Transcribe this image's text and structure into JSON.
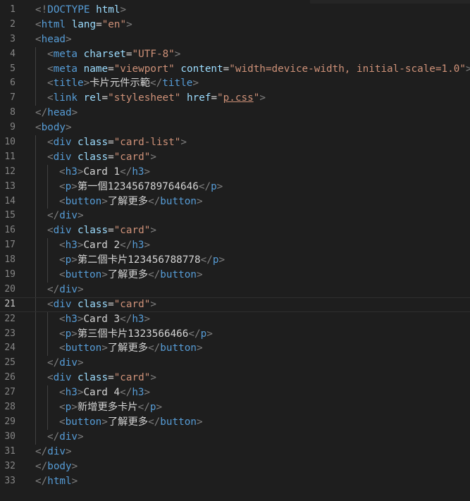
{
  "editor": {
    "language": "html",
    "current_line": 21,
    "colors": {
      "background": "#1e1e1e",
      "tag": "#569cd6",
      "bracket": "#808080",
      "attribute": "#9cdcfe",
      "string": "#ce9178",
      "text": "#d4d4d4",
      "line_number": "#858585"
    },
    "lines": [
      {
        "n": "1",
        "indent": 0,
        "tokens": [
          [
            "b",
            "<!"
          ],
          [
            "t",
            "DOCTYPE"
          ],
          [
            "e",
            " "
          ],
          [
            "a",
            "html"
          ],
          [
            "b",
            ">"
          ]
        ]
      },
      {
        "n": "2",
        "indent": 0,
        "tokens": [
          [
            "b",
            "<"
          ],
          [
            "t",
            "html"
          ],
          [
            "e",
            " "
          ],
          [
            "a",
            "lang"
          ],
          [
            "e",
            "="
          ],
          [
            "s",
            "\"en\""
          ],
          [
            "b",
            ">"
          ]
        ]
      },
      {
        "n": "3",
        "indent": 0,
        "tokens": [
          [
            "b",
            "<"
          ],
          [
            "t",
            "head"
          ],
          [
            "b",
            ">"
          ]
        ]
      },
      {
        "n": "4",
        "indent": 1,
        "tokens": [
          [
            "b",
            "<"
          ],
          [
            "t",
            "meta"
          ],
          [
            "e",
            " "
          ],
          [
            "a",
            "charset"
          ],
          [
            "e",
            "="
          ],
          [
            "s",
            "\"UTF-8\""
          ],
          [
            "b",
            ">"
          ]
        ]
      },
      {
        "n": "5",
        "indent": 1,
        "tokens": [
          [
            "b",
            "<"
          ],
          [
            "t",
            "meta"
          ],
          [
            "e",
            " "
          ],
          [
            "a",
            "name"
          ],
          [
            "e",
            "="
          ],
          [
            "s",
            "\"viewport\""
          ],
          [
            "e",
            " "
          ],
          [
            "a",
            "content"
          ],
          [
            "e",
            "="
          ],
          [
            "s",
            "\"width=device-width, initial-scale=1.0\""
          ],
          [
            "b",
            ">"
          ]
        ]
      },
      {
        "n": "6",
        "indent": 1,
        "tokens": [
          [
            "b",
            "<"
          ],
          [
            "t",
            "title"
          ],
          [
            "b",
            ">"
          ],
          [
            "e",
            "卡片元件示範"
          ],
          [
            "b",
            "</"
          ],
          [
            "t",
            "title"
          ],
          [
            "b",
            ">"
          ]
        ]
      },
      {
        "n": "7",
        "indent": 1,
        "tokens": [
          [
            "b",
            "<"
          ],
          [
            "t",
            "link"
          ],
          [
            "e",
            " "
          ],
          [
            "a",
            "rel"
          ],
          [
            "e",
            "="
          ],
          [
            "s",
            "\"stylesheet\""
          ],
          [
            "e",
            " "
          ],
          [
            "a",
            "href"
          ],
          [
            "e",
            "="
          ],
          [
            "s",
            "\""
          ],
          [
            "su",
            "p.css"
          ],
          [
            "s",
            "\""
          ],
          [
            "b",
            ">"
          ]
        ]
      },
      {
        "n": "8",
        "indent": 0,
        "tokens": [
          [
            "b",
            "</"
          ],
          [
            "t",
            "head"
          ],
          [
            "b",
            ">"
          ]
        ]
      },
      {
        "n": "9",
        "indent": 0,
        "tokens": [
          [
            "b",
            "<"
          ],
          [
            "t",
            "body"
          ],
          [
            "b",
            ">"
          ]
        ]
      },
      {
        "n": "10",
        "indent": 1,
        "tokens": [
          [
            "b",
            "<"
          ],
          [
            "t",
            "div"
          ],
          [
            "e",
            " "
          ],
          [
            "a",
            "class"
          ],
          [
            "e",
            "="
          ],
          [
            "s",
            "\"card-list\""
          ],
          [
            "b",
            ">"
          ]
        ]
      },
      {
        "n": "11",
        "indent": 1,
        "tokens": [
          [
            "b",
            "<"
          ],
          [
            "t",
            "div"
          ],
          [
            "e",
            " "
          ],
          [
            "a",
            "class"
          ],
          [
            "e",
            "="
          ],
          [
            "s",
            "\"card\""
          ],
          [
            "b",
            ">"
          ]
        ]
      },
      {
        "n": "12",
        "indent": 2,
        "tokens": [
          [
            "b",
            "<"
          ],
          [
            "t",
            "h3"
          ],
          [
            "b",
            ">"
          ],
          [
            "e",
            "Card 1"
          ],
          [
            "b",
            "</"
          ],
          [
            "t",
            "h3"
          ],
          [
            "b",
            ">"
          ]
        ]
      },
      {
        "n": "13",
        "indent": 2,
        "tokens": [
          [
            "b",
            "<"
          ],
          [
            "t",
            "p"
          ],
          [
            "b",
            ">"
          ],
          [
            "e",
            "第一個123456789764646"
          ],
          [
            "b",
            "</"
          ],
          [
            "t",
            "p"
          ],
          [
            "b",
            ">"
          ]
        ]
      },
      {
        "n": "14",
        "indent": 2,
        "tokens": [
          [
            "b",
            "<"
          ],
          [
            "t",
            "button"
          ],
          [
            "b",
            ">"
          ],
          [
            "e",
            "了解更多"
          ],
          [
            "b",
            "</"
          ],
          [
            "t",
            "button"
          ],
          [
            "b",
            ">"
          ]
        ]
      },
      {
        "n": "15",
        "indent": 1,
        "tokens": [
          [
            "b",
            "</"
          ],
          [
            "t",
            "div"
          ],
          [
            "b",
            ">"
          ]
        ]
      },
      {
        "n": "16",
        "indent": 1,
        "tokens": [
          [
            "b",
            "<"
          ],
          [
            "t",
            "div"
          ],
          [
            "e",
            " "
          ],
          [
            "a",
            "class"
          ],
          [
            "e",
            "="
          ],
          [
            "s",
            "\"card\""
          ],
          [
            "b",
            ">"
          ]
        ]
      },
      {
        "n": "17",
        "indent": 2,
        "tokens": [
          [
            "b",
            "<"
          ],
          [
            "t",
            "h3"
          ],
          [
            "b",
            ">"
          ],
          [
            "e",
            "Card 2"
          ],
          [
            "b",
            "</"
          ],
          [
            "t",
            "h3"
          ],
          [
            "b",
            ">"
          ]
        ]
      },
      {
        "n": "18",
        "indent": 2,
        "tokens": [
          [
            "b",
            "<"
          ],
          [
            "t",
            "p"
          ],
          [
            "b",
            ">"
          ],
          [
            "e",
            "第二個卡片123456788778"
          ],
          [
            "b",
            "</"
          ],
          [
            "t",
            "p"
          ],
          [
            "b",
            ">"
          ]
        ]
      },
      {
        "n": "19",
        "indent": 2,
        "tokens": [
          [
            "b",
            "<"
          ],
          [
            "t",
            "button"
          ],
          [
            "b",
            ">"
          ],
          [
            "e",
            "了解更多"
          ],
          [
            "b",
            "</"
          ],
          [
            "t",
            "button"
          ],
          [
            "b",
            ">"
          ]
        ]
      },
      {
        "n": "20",
        "indent": 1,
        "tokens": [
          [
            "b",
            "</"
          ],
          [
            "t",
            "div"
          ],
          [
            "b",
            ">"
          ]
        ]
      },
      {
        "n": "21",
        "indent": 1,
        "tokens": [
          [
            "b",
            "<"
          ],
          [
            "t",
            "div"
          ],
          [
            "e",
            " "
          ],
          [
            "a",
            "class"
          ],
          [
            "e",
            "="
          ],
          [
            "s",
            "\"card\""
          ],
          [
            "b",
            ">"
          ]
        ]
      },
      {
        "n": "22",
        "indent": 2,
        "tokens": [
          [
            "b",
            "<"
          ],
          [
            "t",
            "h3"
          ],
          [
            "b",
            ">"
          ],
          [
            "e",
            "Card 3"
          ],
          [
            "b",
            "</"
          ],
          [
            "t",
            "h3"
          ],
          [
            "b",
            ">"
          ]
        ]
      },
      {
        "n": "23",
        "indent": 2,
        "tokens": [
          [
            "b",
            "<"
          ],
          [
            "t",
            "p"
          ],
          [
            "b",
            ">"
          ],
          [
            "e",
            "第三個卡片1323566466"
          ],
          [
            "b",
            "</"
          ],
          [
            "t",
            "p"
          ],
          [
            "b",
            ">"
          ]
        ]
      },
      {
        "n": "24",
        "indent": 2,
        "tokens": [
          [
            "b",
            "<"
          ],
          [
            "t",
            "button"
          ],
          [
            "b",
            ">"
          ],
          [
            "e",
            "了解更多"
          ],
          [
            "b",
            "</"
          ],
          [
            "t",
            "button"
          ],
          [
            "b",
            ">"
          ]
        ]
      },
      {
        "n": "25",
        "indent": 1,
        "tokens": [
          [
            "b",
            "</"
          ],
          [
            "t",
            "div"
          ],
          [
            "b",
            ">"
          ]
        ]
      },
      {
        "n": "26",
        "indent": 1,
        "tokens": [
          [
            "b",
            "<"
          ],
          [
            "t",
            "div"
          ],
          [
            "e",
            " "
          ],
          [
            "a",
            "class"
          ],
          [
            "e",
            "="
          ],
          [
            "s",
            "\"card\""
          ],
          [
            "b",
            ">"
          ]
        ]
      },
      {
        "n": "27",
        "indent": 2,
        "tokens": [
          [
            "b",
            "<"
          ],
          [
            "t",
            "h3"
          ],
          [
            "b",
            ">"
          ],
          [
            "e",
            "Card 4"
          ],
          [
            "b",
            "</"
          ],
          [
            "t",
            "h3"
          ],
          [
            "b",
            ">"
          ]
        ]
      },
      {
        "n": "28",
        "indent": 2,
        "tokens": [
          [
            "b",
            "<"
          ],
          [
            "t",
            "p"
          ],
          [
            "b",
            ">"
          ],
          [
            "e",
            "新增更多卡片"
          ],
          [
            "b",
            "</"
          ],
          [
            "t",
            "p"
          ],
          [
            "b",
            ">"
          ]
        ]
      },
      {
        "n": "29",
        "indent": 2,
        "tokens": [
          [
            "b",
            "<"
          ],
          [
            "t",
            "button"
          ],
          [
            "b",
            ">"
          ],
          [
            "e",
            "了解更多"
          ],
          [
            "b",
            "</"
          ],
          [
            "t",
            "button"
          ],
          [
            "b",
            ">"
          ]
        ]
      },
      {
        "n": "30",
        "indent": 1,
        "tokens": [
          [
            "b",
            "</"
          ],
          [
            "t",
            "div"
          ],
          [
            "b",
            ">"
          ]
        ]
      },
      {
        "n": "31",
        "indent": 0,
        "tokens": [
          [
            "b",
            "</"
          ],
          [
            "t",
            "div"
          ],
          [
            "b",
            ">"
          ]
        ]
      },
      {
        "n": "32",
        "indent": 0,
        "tokens": [
          [
            "b",
            "</"
          ],
          [
            "t",
            "body"
          ],
          [
            "b",
            ">"
          ]
        ]
      },
      {
        "n": "33",
        "indent": 0,
        "tokens": [
          [
            "b",
            "</"
          ],
          [
            "t",
            "html"
          ],
          [
            "b",
            ">"
          ]
        ]
      }
    ]
  }
}
